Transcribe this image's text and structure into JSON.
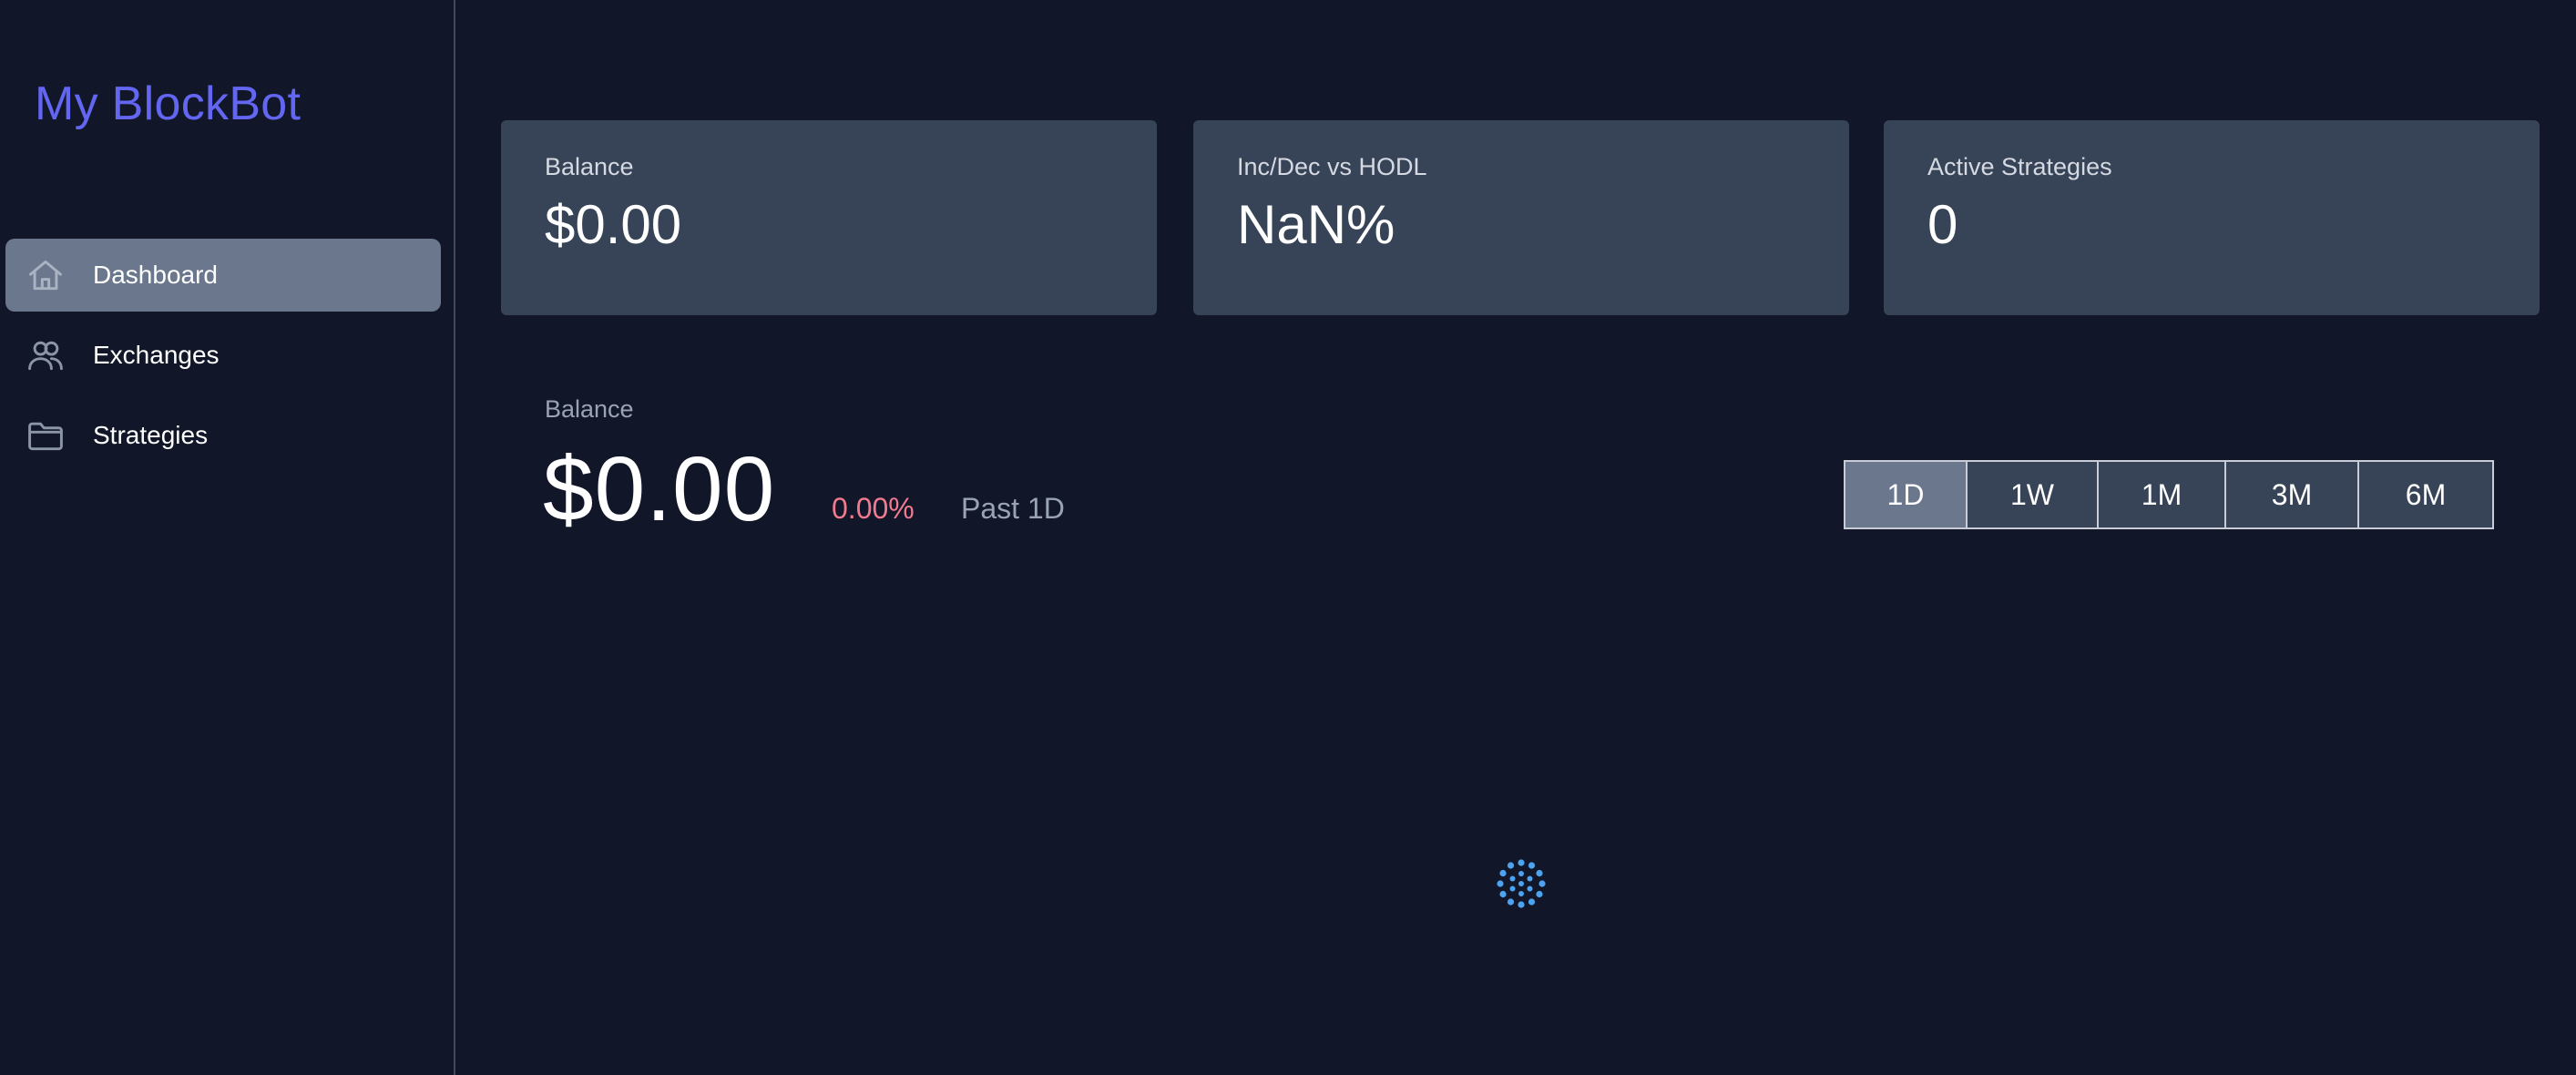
{
  "brand": {
    "title": "My BlockBot",
    "color": "#6366f1"
  },
  "sidebar": {
    "items": [
      {
        "label": "Dashboard",
        "icon": "home-icon",
        "active": true
      },
      {
        "label": "Exchanges",
        "icon": "users-icon",
        "active": false
      },
      {
        "label": "Strategies",
        "icon": "folder-icon",
        "active": false
      }
    ]
  },
  "stats": [
    {
      "label": "Balance",
      "value": "$0.00"
    },
    {
      "label": "Inc/Dec vs HODL",
      "value": "NaN%"
    },
    {
      "label": "Active Strategies",
      "value": "0"
    }
  ],
  "balance": {
    "label": "Balance",
    "value": "$0.00",
    "change": "0.00%",
    "period": "Past 1D",
    "change_color": "#f27a8f"
  },
  "ranges": {
    "options": [
      "1D",
      "1W",
      "1M",
      "3M",
      "6M"
    ],
    "selected": "1D"
  },
  "loading": {
    "icon": "loading-spinner-icon",
    "color": "#4ea3f0"
  }
}
